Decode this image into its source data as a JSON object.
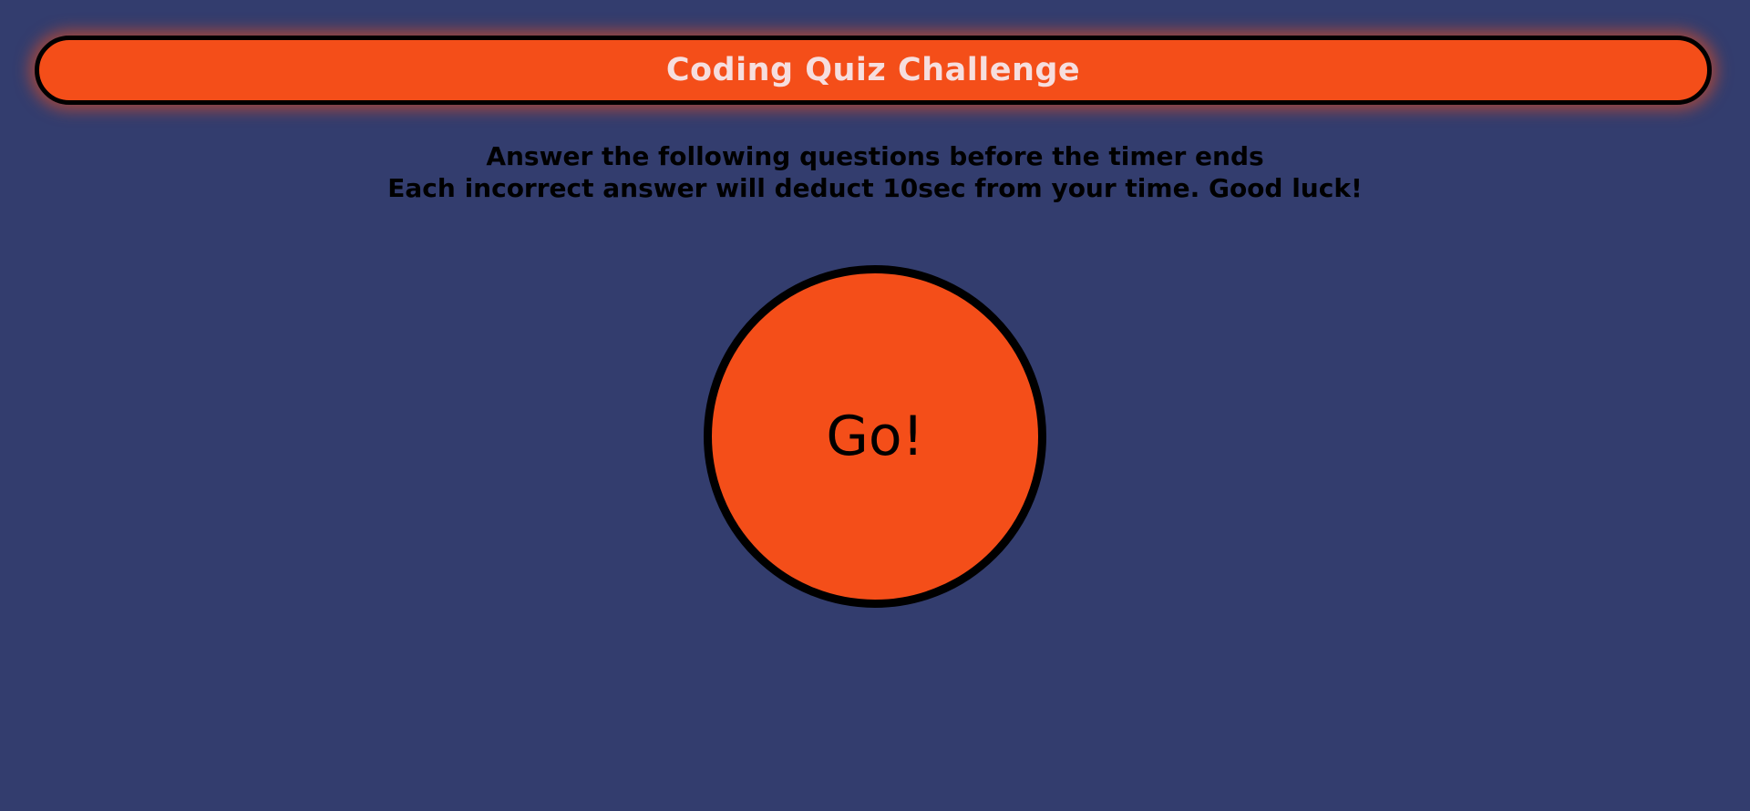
{
  "header": {
    "title": "Coding Quiz Challenge"
  },
  "instructions": {
    "line1": "Answer the following questions before the timer ends",
    "line2": "Each incorrect answer will deduct 10sec from your time. Good luck!"
  },
  "start_button": {
    "label": "Go!"
  },
  "colors": {
    "background": "#333d6e",
    "accent": "#f44e19",
    "header_text": "#f6dede",
    "border": "#000000"
  }
}
